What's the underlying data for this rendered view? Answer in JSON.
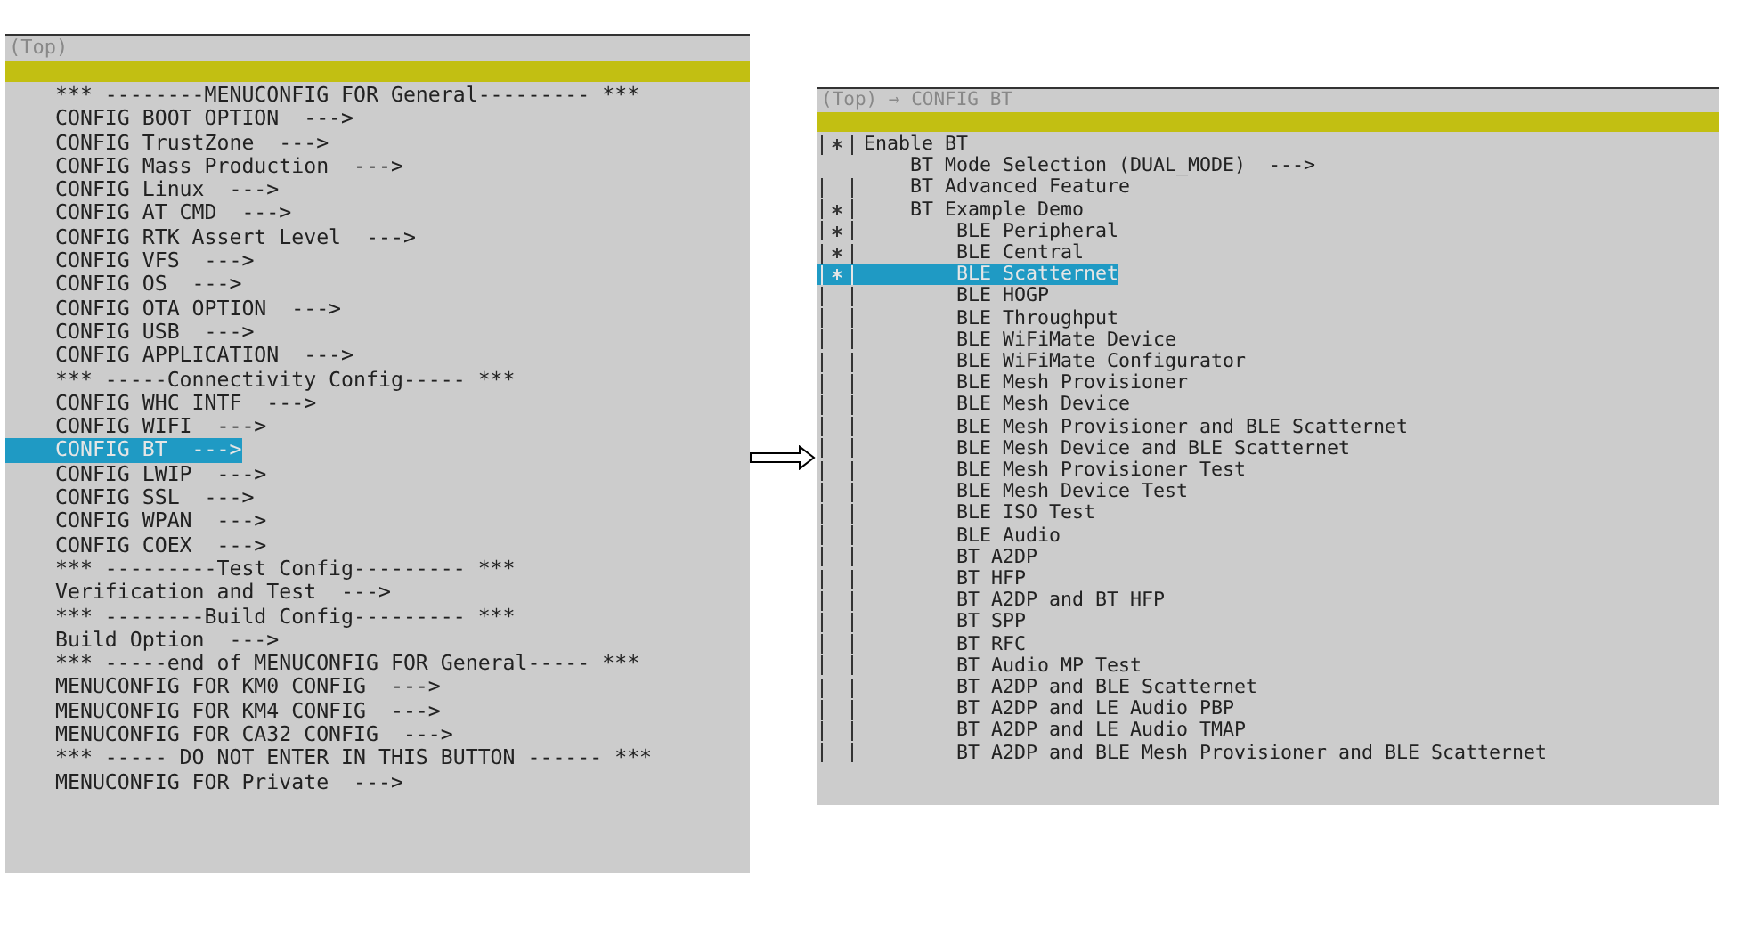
{
  "left_panel": {
    "title": "(Top)",
    "items": [
      {
        "text": "*** --------MENUCONFIG FOR General--------- ***",
        "selected": false
      },
      {
        "text": "CONFIG BOOT OPTION  --->",
        "selected": false
      },
      {
        "text": "CONFIG TrustZone  --->",
        "selected": false
      },
      {
        "text": "CONFIG Mass Production  --->",
        "selected": false
      },
      {
        "text": "CONFIG Linux  --->",
        "selected": false
      },
      {
        "text": "CONFIG AT CMD  --->",
        "selected": false
      },
      {
        "text": "CONFIG RTK Assert Level  --->",
        "selected": false
      },
      {
        "text": "CONFIG VFS  --->",
        "selected": false
      },
      {
        "text": "CONFIG OS  --->",
        "selected": false
      },
      {
        "text": "CONFIG OTA OPTION  --->",
        "selected": false
      },
      {
        "text": "CONFIG USB  --->",
        "selected": false
      },
      {
        "text": "CONFIG APPLICATION  --->",
        "selected": false
      },
      {
        "text": "*** -----Connectivity Config----- ***",
        "selected": false
      },
      {
        "text": "CONFIG WHC INTF  --->",
        "selected": false
      },
      {
        "text": "CONFIG WIFI  --->",
        "selected": false
      },
      {
        "text": "CONFIG BT  --->",
        "selected": true
      },
      {
        "text": "CONFIG LWIP  --->",
        "selected": false
      },
      {
        "text": "CONFIG SSL  --->",
        "selected": false
      },
      {
        "text": "CONFIG WPAN  --->",
        "selected": false
      },
      {
        "text": "CONFIG COEX  --->",
        "selected": false
      },
      {
        "text": "*** ---------Test Config--------- ***",
        "selected": false
      },
      {
        "text": "Verification and Test  --->",
        "selected": false
      },
      {
        "text": "*** --------Build Config--------- ***",
        "selected": false
      },
      {
        "text": "Build Option  --->",
        "selected": false
      },
      {
        "text": "*** -----end of MENUCONFIG FOR General----- ***",
        "selected": false
      },
      {
        "text": "MENUCONFIG FOR KM0 CONFIG  --->",
        "selected": false
      },
      {
        "text": "MENUCONFIG FOR KM4 CONFIG  --->",
        "selected": false
      },
      {
        "text": "MENUCONFIG FOR CA32 CONFIG  --->",
        "selected": false
      },
      {
        "text": "*** ----- DO NOT ENTER IN THIS BUTTON ------ ***",
        "selected": false
      },
      {
        "text": "MENUCONFIG FOR Private  --->",
        "selected": false
      }
    ]
  },
  "right_panel": {
    "title": "(Top) → CONFIG BT",
    "items": [
      {
        "kind": "bool",
        "text": "Enable BT",
        "checked": true,
        "selected": false,
        "children": [
          {
            "kind": "option",
            "text": "BT Mode Selection (DUAL_MODE)  --->",
            "selected": false
          },
          {
            "kind": "bool",
            "text": "BT Advanced Feature",
            "checked": false,
            "selected": false
          },
          {
            "kind": "bool",
            "text": "BT Example Demo",
            "checked": true,
            "selected": false,
            "children": [
              {
                "kind": "bool",
                "text": "BLE Peripheral",
                "checked": true,
                "selected": false
              },
              {
                "kind": "bool",
                "text": "BLE Central",
                "checked": true,
                "selected": false
              },
              {
                "kind": "bool",
                "text": "BLE Scatternet",
                "checked": true,
                "selected": true
              },
              {
                "kind": "bool",
                "text": "BLE HOGP",
                "checked": false,
                "selected": false
              },
              {
                "kind": "bool",
                "text": "BLE Throughput",
                "checked": false,
                "selected": false
              },
              {
                "kind": "bool",
                "text": "BLE WiFiMate Device",
                "checked": false,
                "selected": false
              },
              {
                "kind": "bool",
                "text": "BLE WiFiMate Configurator",
                "checked": false,
                "selected": false
              },
              {
                "kind": "bool",
                "text": "BLE Mesh Provisioner",
                "checked": false,
                "selected": false
              },
              {
                "kind": "bool",
                "text": "BLE Mesh Device",
                "checked": false,
                "selected": false
              },
              {
                "kind": "bool",
                "text": "BLE Mesh Provisioner and BLE Scatternet",
                "checked": false,
                "selected": false
              },
              {
                "kind": "bool",
                "text": "BLE Mesh Device and BLE Scatternet",
                "checked": false,
                "selected": false
              },
              {
                "kind": "bool",
                "text": "BLE Mesh Provisioner Test",
                "checked": false,
                "selected": false
              },
              {
                "kind": "bool",
                "text": "BLE Mesh Device Test",
                "checked": false,
                "selected": false
              },
              {
                "kind": "bool",
                "text": "BLE ISO Test",
                "checked": false,
                "selected": false
              },
              {
                "kind": "bool",
                "text": "BLE Audio",
                "checked": false,
                "selected": false
              },
              {
                "kind": "bool",
                "text": "BT A2DP",
                "checked": false,
                "selected": false
              },
              {
                "kind": "bool",
                "text": "BT HFP",
                "checked": false,
                "selected": false
              },
              {
                "kind": "bool",
                "text": "BT A2DP and BT HFP",
                "checked": false,
                "selected": false
              },
              {
                "kind": "bool",
                "text": "BT SPP",
                "checked": false,
                "selected": false
              },
              {
                "kind": "bool",
                "text": "BT RFC",
                "checked": false,
                "selected": false
              },
              {
                "kind": "bool",
                "text": "BT Audio MP Test",
                "checked": false,
                "selected": false
              },
              {
                "kind": "bool",
                "text": "BT A2DP and BLE Scatternet",
                "checked": false,
                "selected": false
              },
              {
                "kind": "bool",
                "text": "BT A2DP and LE Audio PBP",
                "checked": false,
                "selected": false
              },
              {
                "kind": "bool",
                "text": "BT A2DP and LE Audio TMAP",
                "checked": false,
                "selected": false
              },
              {
                "kind": "bool",
                "text": "BT A2DP and BLE Mesh Provisioner and BLE Scatternet",
                "checked": false,
                "selected": false
              }
            ]
          }
        ]
      }
    ]
  }
}
